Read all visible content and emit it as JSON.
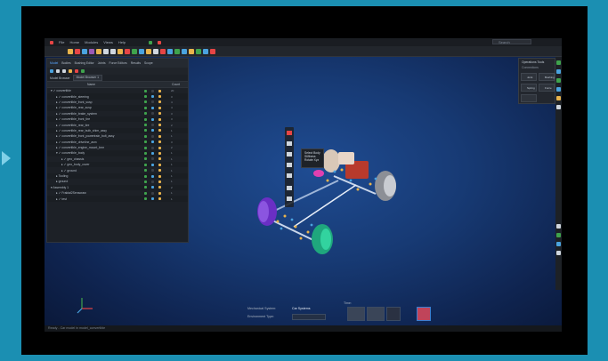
{
  "window": {
    "menu": [
      "File",
      "Home",
      "Modules",
      "Views",
      "Help"
    ],
    "search_placeholder": "Search"
  },
  "panel": {
    "tabs": [
      "Model",
      "Bodies",
      "Bushing Editor",
      "Joints",
      "Force Editors",
      "Results",
      "Scope"
    ],
    "selector_label": "Model Browser",
    "selector_value": "Model Browser 1",
    "columns": [
      "Name",
      "",
      "",
      "",
      "Count"
    ],
    "rows": [
      {
        "name": "▾ ✓ convertible",
        "indent": 4,
        "count": "20"
      },
      {
        "name": "▸ ✓ convertible_steering",
        "indent": 10,
        "count": "3"
      },
      {
        "name": "▸ ✓ convertible_front_susp",
        "indent": 10,
        "count": "4"
      },
      {
        "name": "▸ ✓ convertible_rear_susp",
        "indent": 10,
        "count": "4"
      },
      {
        "name": "▸ ✓ convertible_brake_system",
        "indent": 10,
        "count": "3"
      },
      {
        "name": "▸ ✓ convertible_front_tire",
        "indent": 10,
        "count": "3"
      },
      {
        "name": "▸ ✓ convertible_rear_tire",
        "indent": 10,
        "count": "2"
      },
      {
        "name": "▸ ✓ convertible_rear_bulb_shim_assy",
        "indent": 10,
        "count": "1"
      },
      {
        "name": "▸ ✓ convertible_front_powertrain_bolt_assy",
        "indent": 10,
        "count": "1"
      },
      {
        "name": "▸ ✓ convertible_driveline_asm",
        "indent": 10,
        "count": "3"
      },
      {
        "name": "▸ ✓ convertible_engine_mount_bmr",
        "indent": 10,
        "count": "2"
      },
      {
        "name": "▾ ✓ convertible_body",
        "indent": 10,
        "count": "1"
      },
      {
        "name": "▸ ✓ geo_chassis",
        "indent": 16,
        "count": "1"
      },
      {
        "name": "▸ ✓ geo_body_cover",
        "indent": 16,
        "count": "1"
      },
      {
        "name": "▸ ✓ ground",
        "indent": 16,
        "count": "1"
      },
      {
        "name": "▸ Tooling",
        "indent": 10,
        "count": "1"
      },
      {
        "name": "▸ ground",
        "indent": 10,
        "count": "1"
      },
      {
        "name": "▾ Assembly 1",
        "indent": 4,
        "count": "2"
      },
      {
        "name": "▸ ✓ Fraktal2Sensoraw",
        "indent": 10,
        "count": "1"
      },
      {
        "name": "▸ ✓ test",
        "indent": 10,
        "count": "1"
      }
    ]
  },
  "right_panel": {
    "title": "Operations Tools",
    "subtitle": "Connections",
    "buttons": [
      "Joint",
      "Bushing",
      "Spring",
      "Force"
    ]
  },
  "context_menu": [
    "Select Body",
    "Stiffness",
    "Rotate Xyz"
  ],
  "bottom": {
    "mechanism_label": "Mechanical System:",
    "mechanism_value": "Car Systems",
    "environment_label": "Environment Type:",
    "env_value": "",
    "time_label": "Time:"
  },
  "status_text": "Ready - Car model in model_convertible",
  "colors": {
    "accent": "#58a6ff",
    "viewport_bg": "#173a74",
    "page_bg": "#1b8fb2"
  }
}
